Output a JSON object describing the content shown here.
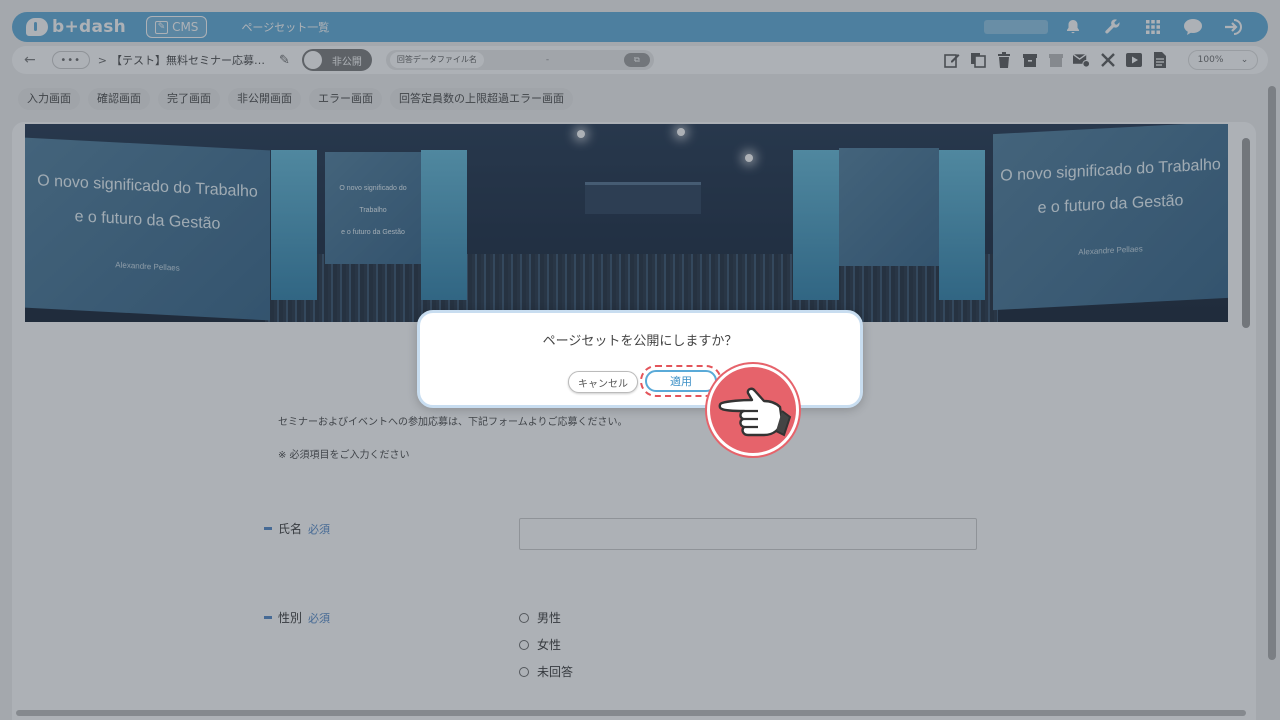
{
  "app": {
    "logo_text": "b+dash",
    "module_badge": "CMS",
    "page_title": "ページセット一覧"
  },
  "top_icons": [
    "bell-icon",
    "wrench-icon",
    "grid-icon",
    "chat-icon",
    "logout-icon"
  ],
  "toolbar": {
    "dots": "•••",
    "crumb_sep": ">",
    "breadcrumb": "【テスト】無料セミナー応募…",
    "toggle_label": "非公開",
    "file_label": "回答データファイル名",
    "file_value": "-",
    "zoom": "100%",
    "zoom_chevron": "⌄"
  },
  "tabs": [
    "入力画面",
    "確認画面",
    "完了画面",
    "非公開画面",
    "エラー画面",
    "回答定員数の上限超過エラー画面"
  ],
  "hero": {
    "left_title_1": "O novo significado do Trabalho",
    "left_title_2": "e o futuro da Gestão",
    "left_author": "Alexandre Pellaes",
    "mid_title_1": "O novo significado do Trabalho",
    "mid_title_2": "e o futuro da Gestão",
    "right_title_1": "O novo significado do Trabalho",
    "right_title_2": "e o futuro da Gestão",
    "right_author": "Alexandre Pellaes"
  },
  "form": {
    "intro": "セミナーおよびイベントへの参加応募は、下記フォームよりご応募ください。",
    "required_note": "※ 必須項目をご入力ください",
    "name_label": "氏名",
    "required_tag": "必須",
    "gender_label": "性別",
    "gender_options": [
      "男性",
      "女性",
      "未回答"
    ]
  },
  "dialog": {
    "message": "ページセットを公開にしますか？",
    "cancel_label": "キャンセル",
    "apply_label": "適用"
  },
  "colors": {
    "brand": "#5aaad8",
    "highlight": "#e3545a",
    "required": "#4f86c6"
  }
}
